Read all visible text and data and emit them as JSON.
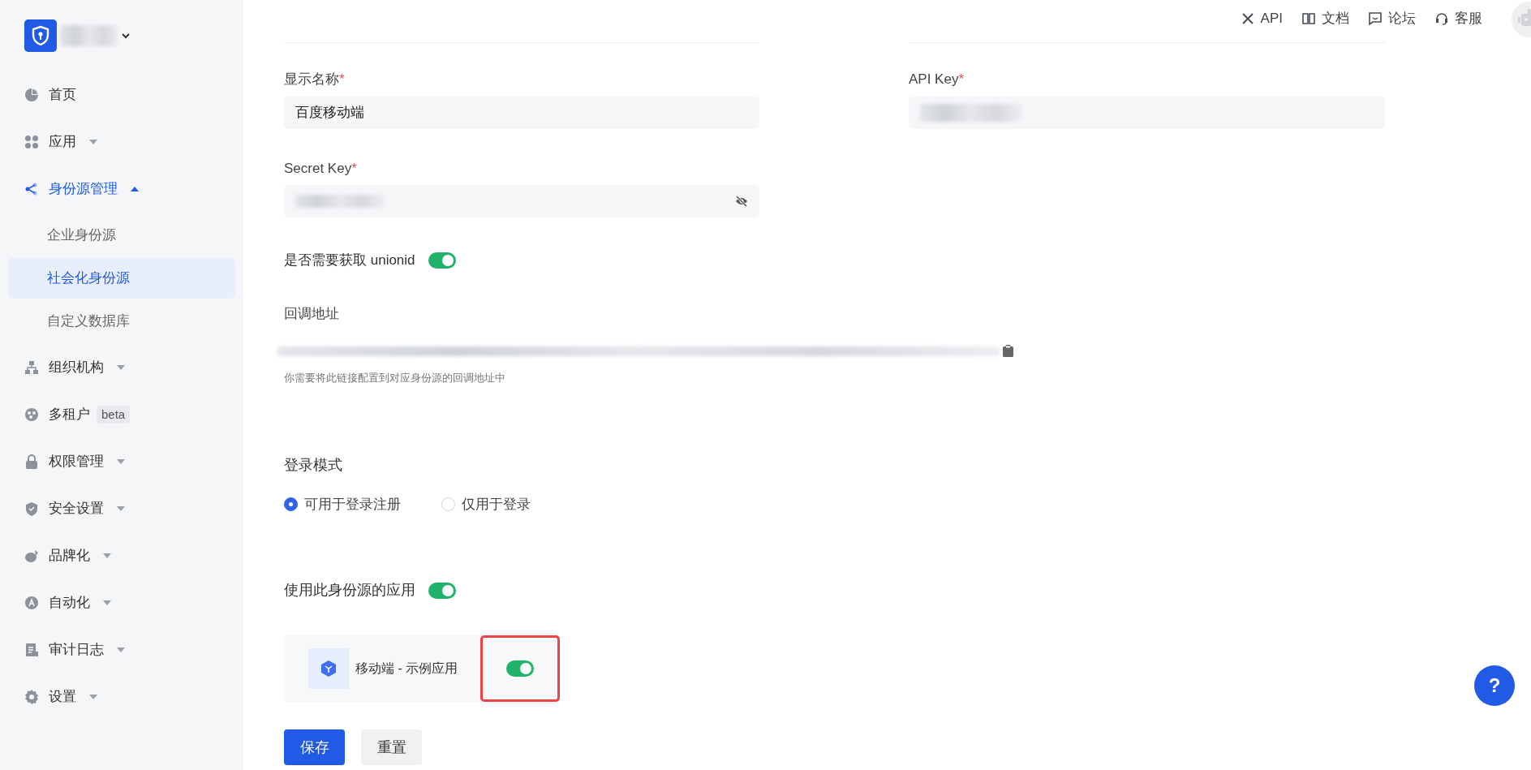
{
  "sidebar": {
    "items": [
      {
        "label": "首页",
        "selected": false
      },
      {
        "label": "应用",
        "expanded": false,
        "selected": false
      },
      {
        "label": "身份源管理",
        "expanded": true,
        "selected": true,
        "children": [
          {
            "label": "企业身份源",
            "selected": false
          },
          {
            "label": "社会化身份源",
            "selected": true
          },
          {
            "label": "自定义数据库",
            "selected": false
          }
        ]
      },
      {
        "label": "组织机构",
        "expanded": false,
        "selected": false
      },
      {
        "label": "多租户",
        "selected": false,
        "badge": "beta"
      },
      {
        "label": "权限管理",
        "expanded": false,
        "selected": false
      },
      {
        "label": "安全设置",
        "expanded": false,
        "selected": false
      },
      {
        "label": "品牌化",
        "expanded": false,
        "selected": false
      },
      {
        "label": "自动化",
        "expanded": false,
        "selected": false
      },
      {
        "label": "审计日志",
        "expanded": false,
        "selected": false
      },
      {
        "label": "设置",
        "expanded": false,
        "selected": false
      }
    ]
  },
  "topbar": {
    "links": [
      {
        "label": "API"
      },
      {
        "label": "文档"
      },
      {
        "label": "论坛"
      },
      {
        "label": "客服"
      }
    ]
  },
  "form": {
    "display_name": {
      "label": "显示名称",
      "required_mark": "*",
      "value": "百度移动端"
    },
    "api_key": {
      "label": "API Key",
      "required_mark": "*"
    },
    "secret_key": {
      "label": "Secret Key",
      "required_mark": "*"
    },
    "unionid": {
      "label": "是否需要获取 unionid",
      "on": true
    },
    "callback": {
      "label": "回调地址",
      "hint": "你需要将此链接配置到对应身份源的回调地址中"
    },
    "login_mode": {
      "label": "登录模式",
      "options": [
        {
          "label": "可用于登录注册",
          "selected": true
        },
        {
          "label": "仅用于登录",
          "selected": false
        }
      ]
    },
    "apps": {
      "label": "使用此身份源的应用",
      "on": true,
      "items": [
        {
          "name": "移动端 - 示例应用",
          "on": true,
          "highlighted": true
        }
      ]
    },
    "buttons": [
      {
        "label": "保存",
        "kind": "primary"
      },
      {
        "label": "重置",
        "kind": "secondary"
      }
    ]
  },
  "help_button": {
    "label": "?"
  }
}
